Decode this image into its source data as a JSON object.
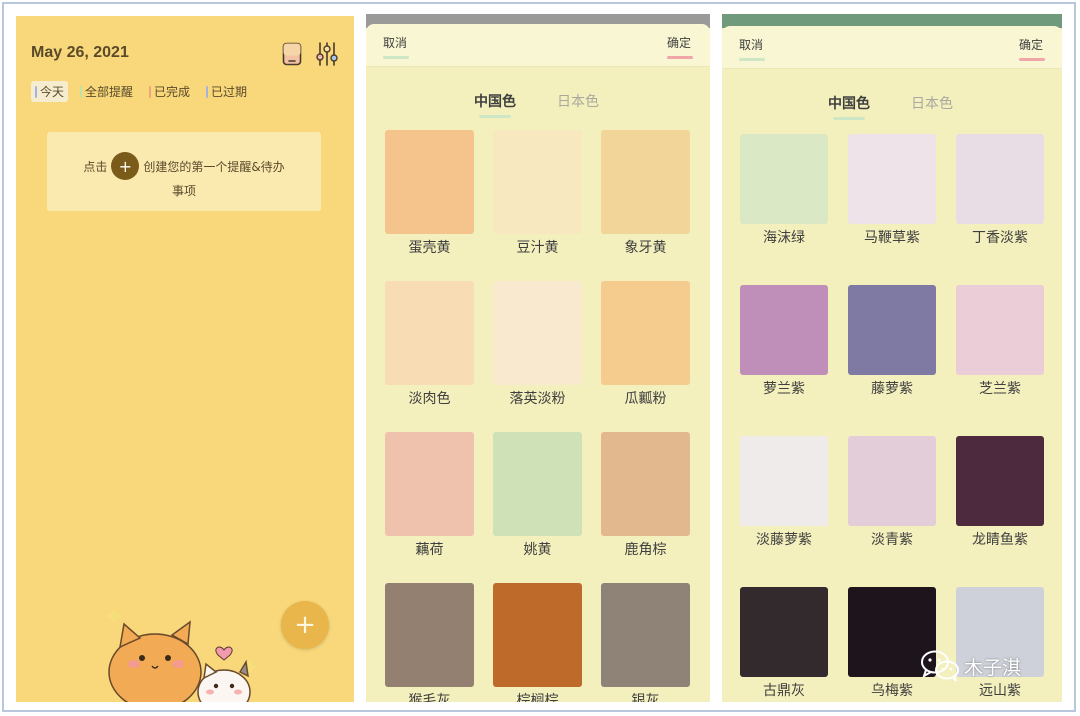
{
  "panel1": {
    "date": "May 26, 2021",
    "filters": [
      {
        "label": "今天",
        "color": "#9fb3e6",
        "active": true
      },
      {
        "label": "全部提醒",
        "color": "#bfe3a7",
        "active": false
      },
      {
        "label": "已完成",
        "color": "#f1a27a",
        "active": false
      },
      {
        "label": "已过期",
        "color": "#aab0d8",
        "active": false
      }
    ],
    "hint_before": "点击",
    "hint_plus": "+",
    "hint_after": "创建您的第一个提醒&待办",
    "hint_line2": "事项",
    "fab": "+",
    "bg_color": "#f8d87b"
  },
  "panel2": {
    "cancel": "取消",
    "confirm": "确定",
    "tabs": [
      "中国色",
      "日本色"
    ],
    "swatches": [
      {
        "name": "蛋壳黄",
        "color": "#f5c48d"
      },
      {
        "name": "豆汁黄",
        "color": "#f8e8c0"
      },
      {
        "name": "象牙黄",
        "color": "#f2d599"
      },
      {
        "name": "淡肉色",
        "color": "#f8dcb4"
      },
      {
        "name": "落英淡粉",
        "color": "#f8e9cf"
      },
      {
        "name": "瓜瓤粉",
        "color": "#f5cc8d"
      },
      {
        "name": "藕荷",
        "color": "#efc2ae"
      },
      {
        "name": "姚黄",
        "color": "#cfe1b6"
      },
      {
        "name": "鹿角棕",
        "color": "#e2b88f"
      },
      {
        "name": "猴毛灰",
        "color": "#938070"
      },
      {
        "name": "棕榈棕",
        "color": "#bd6a2b"
      },
      {
        "name": "银灰",
        "color": "#8f8378"
      }
    ]
  },
  "panel3": {
    "cancel": "取消",
    "confirm": "确定",
    "tabs": [
      "中国色",
      "日本色"
    ],
    "swatches": [
      {
        "name": "海沫绿",
        "color": "#dbe8c6"
      },
      {
        "name": "马鞭草紫",
        "color": "#ede3e9"
      },
      {
        "name": "丁香淡紫",
        "color": "#e9dde5"
      },
      {
        "name": "萝兰紫",
        "color": "#bf8fba"
      },
      {
        "name": "藤萝紫",
        "color": "#7e7aa3"
      },
      {
        "name": "芝兰紫",
        "color": "#ebcdd7"
      },
      {
        "name": "淡藤萝紫",
        "color": "#f0ebeb"
      },
      {
        "name": "淡青紫",
        "color": "#e3cdd9"
      },
      {
        "name": "龙睛鱼紫",
        "color": "#4e2a3f"
      },
      {
        "name": "古鼎灰",
        "color": "#322a2c"
      },
      {
        "name": "乌梅紫",
        "color": "#1e141b"
      },
      {
        "name": "远山紫",
        "color": "#ced1d9"
      }
    ]
  },
  "watermark": "木子淇"
}
